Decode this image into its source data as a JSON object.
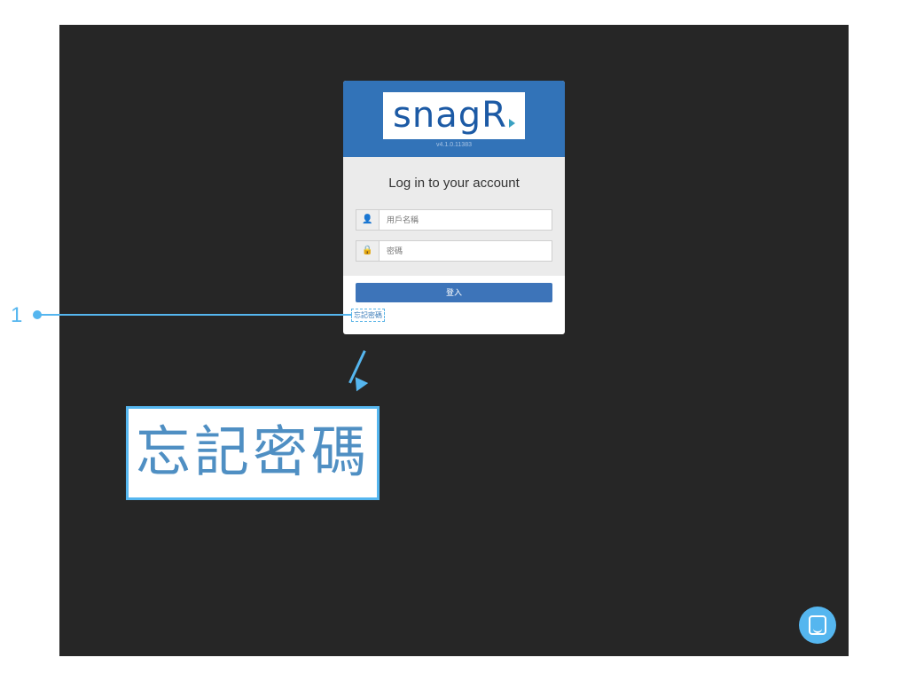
{
  "annotation": {
    "number": "1",
    "zoom_text": "忘記密碼"
  },
  "login": {
    "logo_text": "snagR",
    "version": "v4.1.0.11383",
    "title": "Log in to your account",
    "username_placeholder": "用戶名稱",
    "password_placeholder": "密碼",
    "login_button": "登入",
    "forgot_password": "忘記密碼"
  },
  "icons": {
    "username": "user-icon",
    "password": "lock-icon",
    "chat": "chat-icon"
  },
  "colors": {
    "brand_blue": "#3273b8",
    "annotation_blue": "#55b6ef",
    "background": "#262626"
  }
}
